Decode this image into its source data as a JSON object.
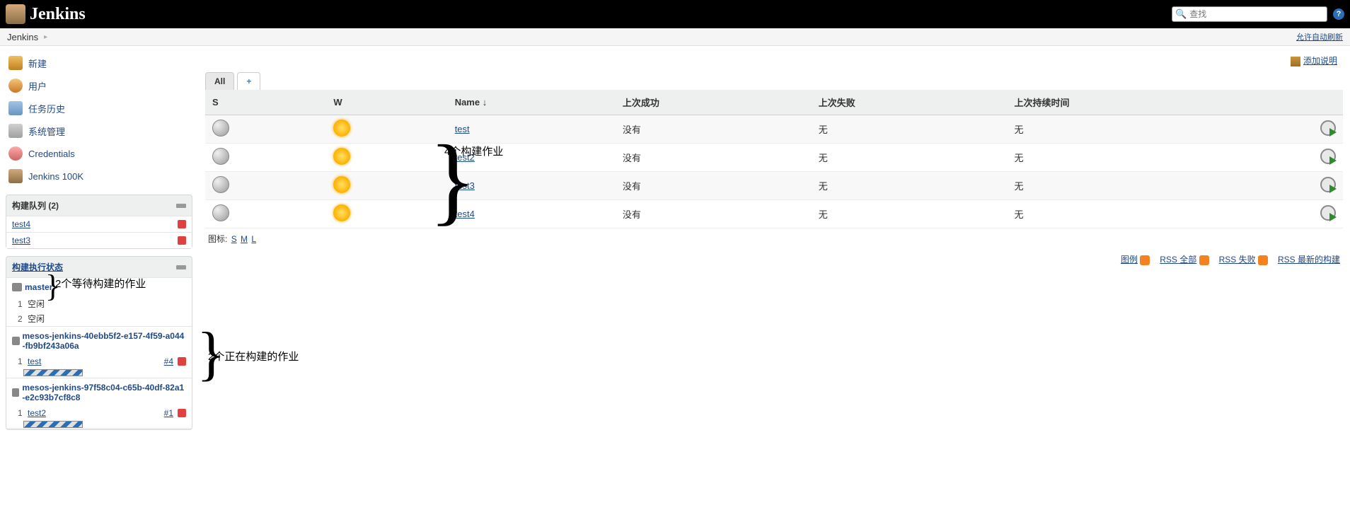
{
  "header": {
    "logo_text": "Jenkins",
    "search_placeholder": "查找"
  },
  "breadcrumb": {
    "root": "Jenkins",
    "auto_refresh": "允许自动刷新"
  },
  "sidebar": {
    "nav": [
      {
        "label": "新建"
      },
      {
        "label": "用户"
      },
      {
        "label": "任务历史"
      },
      {
        "label": "系统管理"
      },
      {
        "label": "Credentials"
      },
      {
        "label": "Jenkins 100K"
      }
    ],
    "build_queue_title": "构建队列 (2)",
    "build_queue_items": [
      {
        "name": "test4"
      },
      {
        "name": "test3"
      }
    ],
    "exec_title": "构建执行状态",
    "executors": {
      "master": {
        "name": "master",
        "slots": [
          {
            "n": "1",
            "state": "空闲"
          },
          {
            "n": "2",
            "state": "空闲"
          }
        ]
      },
      "nodes": [
        {
          "name": "mesos-jenkins-40ebb5f2-e157-4f59-a044-fb9bf243a06a",
          "slot": "1",
          "job": "test",
          "build": "#4"
        },
        {
          "name": "mesos-jenkins-97f58c04-c65b-40df-82a1-e2c93b7cf8c8",
          "slot": "1",
          "job": "test2",
          "build": "#1"
        }
      ]
    }
  },
  "main": {
    "add_desc": "添加说明",
    "tabs": {
      "all": "All",
      "add": "+"
    },
    "columns": {
      "s": "S",
      "w": "W",
      "name": "Name",
      "sort": "↓",
      "last_success": "上次成功",
      "last_fail": "上次失败",
      "last_dur": "上次持续时间"
    },
    "jobs": [
      {
        "name": "test",
        "ls": "没有",
        "lf": "无",
        "ld": "无"
      },
      {
        "name": "test2",
        "ls": "没有",
        "lf": "无",
        "ld": "无"
      },
      {
        "name": "test3",
        "ls": "没有",
        "lf": "无",
        "ld": "无"
      },
      {
        "name": "test4",
        "ls": "没有",
        "lf": "无",
        "ld": "无"
      }
    ],
    "icon_label": "图标:",
    "icon_s": "S",
    "icon_m": "M",
    "icon_l": "L",
    "legend": "图例",
    "rss_all": "RSS 全部",
    "rss_fail": "RSS 失败",
    "rss_latest": "RSS 最新的构建"
  },
  "annotations": {
    "four_jobs": "4个构建作业",
    "two_waiting": "2个等待构建的作业",
    "two_running": "2个正在构建的作业"
  }
}
